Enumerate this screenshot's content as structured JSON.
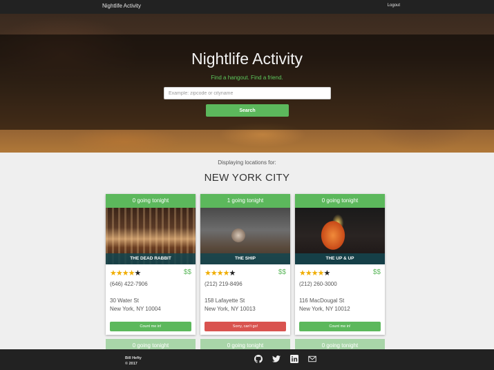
{
  "nav": {
    "brand": "Nightlife Activity",
    "logout": "Logout"
  },
  "hero": {
    "title": "Nightlife Activity",
    "tagline": "Find a hangout. Find a friend.",
    "search_placeholder": "Example: zipcode or cityname",
    "search_button": "Search"
  },
  "results": {
    "displaying": "Displaying locations for:",
    "city": "NEW YORK CITY"
  },
  "cards": [
    {
      "going": "0 going tonight",
      "name": "THE DEAD RABBIT",
      "stars": 4,
      "price": "$$",
      "phone": "(646) 422-7906",
      "addr1": "30 Water St",
      "addr2": "New York, NY 10004",
      "button": "Count me in!"
    },
    {
      "going": "1 going tonight",
      "name": "THE SHIP",
      "stars": 4,
      "price": "$$",
      "phone": "(212) 219-8496",
      "addr1": "158 Lafayette St",
      "addr2": "New York, NY 10013",
      "button": "Sorry, can't go!"
    },
    {
      "going": "0 going tonight",
      "name": "THE UP & UP",
      "stars": 4,
      "price": "$$",
      "phone": "(212) 260-3000",
      "addr1": "116 MacDougal St",
      "addr2": "New York, NY 10012",
      "button": "Count me in!"
    }
  ],
  "next_row": [
    "0 going tonight",
    "0 going tonight",
    "0 going tonight"
  ],
  "footer": {
    "name": "Bill Hefty",
    "year": "© 2017",
    "icons": [
      "github-icon",
      "twitter-icon",
      "linkedin-icon",
      "mail-icon"
    ]
  },
  "colors": {
    "accent": "#5cb85c",
    "danger": "#d9534f",
    "star": "#f0ad00",
    "nav": "#222222"
  }
}
